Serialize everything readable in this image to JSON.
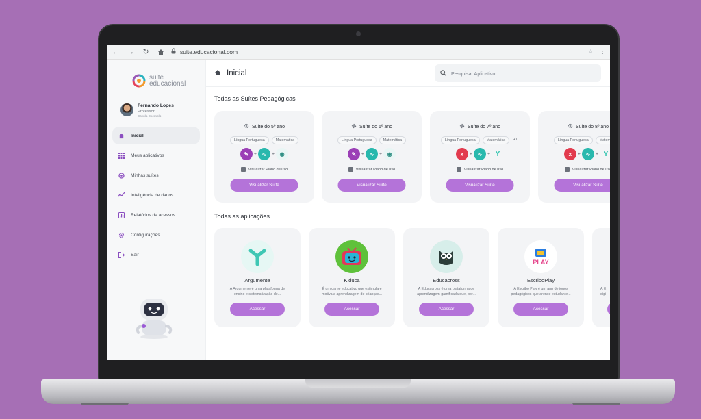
{
  "browser": {
    "url": "suite.educacional.com"
  },
  "brand": {
    "logo_text_1": "suite",
    "logo_text_2": "educacional",
    "accent": "#b473d9",
    "background": "#a66fb5"
  },
  "user": {
    "name": "Fernando Lopes",
    "role": "Professor",
    "school": "Escola Exemplo"
  },
  "sidebar": {
    "items": [
      {
        "label": "Inicial",
        "icon": "home-icon"
      },
      {
        "label": "Meus aplicativos",
        "icon": "grid-icon"
      },
      {
        "label": "Minhas suítes",
        "icon": "suite-icon"
      },
      {
        "label": "Inteligência de dados",
        "icon": "chart-line-icon"
      },
      {
        "label": "Relatórios de acessos",
        "icon": "report-icon"
      },
      {
        "label": "Configurações",
        "icon": "gear-icon"
      },
      {
        "label": "Sair",
        "icon": "logout-icon"
      }
    ]
  },
  "header": {
    "title": "Inicial",
    "search_placeholder": "Pesquisar Aplicativo"
  },
  "suites_section": {
    "title": "Todas as Suítes Pedagógicas",
    "plan_label": "Visualizar Plano de uso",
    "button_label": "Visualizar Suíte",
    "cards": [
      {
        "title": "Suíte do 5º ano",
        "tags": [
          "Língua Portuguesa",
          "Matemática"
        ]
      },
      {
        "title": "Suíte do 6º ano",
        "tags": [
          "Língua Portuguesa",
          "Matemática"
        ]
      },
      {
        "title": "Suíte do 7º ano",
        "tags": [
          "Língua Portuguesa",
          "Matemática",
          "+1"
        ]
      },
      {
        "title": "Suíte do 8º ano",
        "tags": [
          "Língua Portuguesa",
          "Matemática"
        ]
      }
    ]
  },
  "apps_section": {
    "title": "Todas as aplicações",
    "button_label": "Acessar",
    "cards": [
      {
        "name": "Argumente",
        "desc_1": "A Argumente é uma plataforma de",
        "desc_2": "ensino e sistematização de..."
      },
      {
        "name": "Kiduca",
        "desc_1": "É um game educativo que estimula e",
        "desc_2": "motiva a aprendizagem de crianças..."
      },
      {
        "name": "Educacross",
        "desc_1": "A Educacross é uma plataforma de",
        "desc_2": "aprendizagem gamificada que, por..."
      },
      {
        "name": "EscriboPlay",
        "desc_1": "A Escribo Play é um app de jogos",
        "desc_2": "pedagógicos que arence estudante..."
      },
      {
        "name": "",
        "desc_1": "A E",
        "desc_2": "digi"
      }
    ]
  }
}
